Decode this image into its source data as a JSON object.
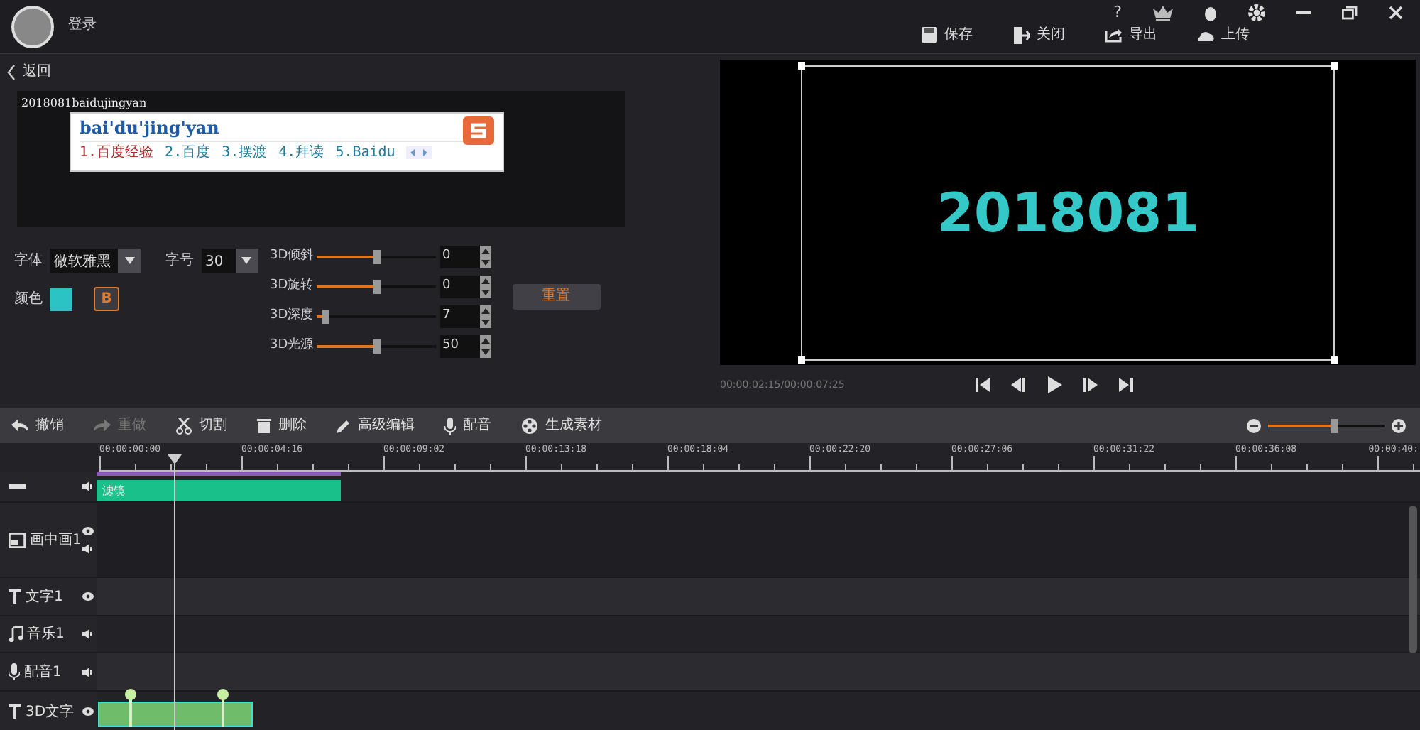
{
  "header": {
    "login": "登录",
    "help": "?"
  },
  "toolbar": [
    {
      "kind": "save",
      "label": "保存"
    },
    {
      "kind": "exit",
      "label": "关闭"
    },
    {
      "kind": "export",
      "label": "导出"
    },
    {
      "kind": "upload",
      "label": "上传"
    }
  ],
  "back": "返回",
  "editor": {
    "text": "2018081baidujingyan",
    "ime": {
      "composition": "bai'du'jing'yan",
      "candidates": [
        {
          "label": "1.百度经验",
          "selected": true
        },
        {
          "label": "2.百度",
          "selected": false
        },
        {
          "label": "3.摆渡",
          "selected": false
        },
        {
          "label": "4.拜读",
          "selected": false
        },
        {
          "label": "5.Baidu",
          "selected": false
        }
      ]
    }
  },
  "font": {
    "label": "字体",
    "value": "微软雅黑"
  },
  "size": {
    "label": "字号",
    "value": "30"
  },
  "color": {
    "label": "颜色",
    "color": "#2bc3c3"
  },
  "bold": {
    "label": "B",
    "on": true
  },
  "sliders": [
    {
      "label": "3D倾斜",
      "level": 0.5,
      "value": "0"
    },
    {
      "label": "3D旋转",
      "level": 0.5,
      "value": "0"
    },
    {
      "label": "3D深度",
      "level": 0.07,
      "value": "7"
    },
    {
      "label": "3D光源",
      "level": 0.5,
      "value": "50"
    }
  ],
  "reset": "重置",
  "preview": {
    "text": "2018081",
    "time": "00:00:02:15/00:00:07:25"
  },
  "edit_tools": [
    {
      "kind": "undo",
      "label": "撤销",
      "disabled": false
    },
    {
      "kind": "redo",
      "label": "重做",
      "disabled": true
    },
    {
      "kind": "cut",
      "label": "切割",
      "disabled": false
    },
    {
      "kind": "delete",
      "label": "删除",
      "disabled": false
    },
    {
      "kind": "edit",
      "label": "高级编辑",
      "disabled": false
    },
    {
      "kind": "mic",
      "label": "配音",
      "disabled": false
    },
    {
      "kind": "film",
      "label": "生成素材",
      "disabled": false
    }
  ],
  "zoom": {
    "level": 0.57
  },
  "ruler": [
    "00:00:00:00",
    "00:00:04:16",
    "00:00:09:02",
    "00:00:13:18",
    "00:00:18:04",
    "00:00:22:20",
    "00:00:27:06",
    "00:00:31:22",
    "00:00:36:08",
    "00:00:40:"
  ],
  "tracks": [
    {
      "kind": "video",
      "clips": [
        {
          "kind": "filter",
          "text": "滤镜"
        }
      ]
    },
    {
      "kind": "pip",
      "label": "画中画1"
    },
    {
      "kind": "text",
      "label": "文字1"
    },
    {
      "kind": "music",
      "label": "音乐1"
    },
    {
      "kind": "voice",
      "label": "配音1"
    },
    {
      "kind": "text3d",
      "label": "3D文字",
      "clips": [
        {
          "kind": "text3d"
        }
      ]
    }
  ]
}
